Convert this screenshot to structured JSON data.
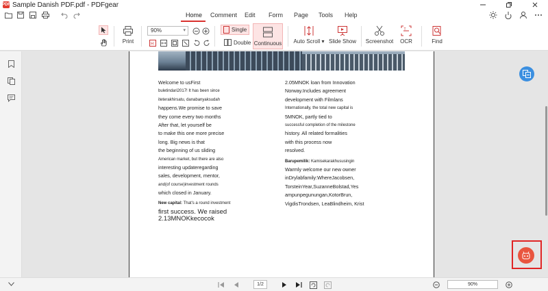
{
  "window": {
    "title": "Sample Danish PDF.pdf - PDFgear",
    "logo_text": "PDF"
  },
  "tabs": [
    {
      "label": "Home"
    },
    {
      "label": "Comment"
    },
    {
      "label": "Edit"
    },
    {
      "label": "Form"
    },
    {
      "label": "Page"
    },
    {
      "label": "Tools"
    },
    {
      "label": "Help"
    }
  ],
  "ribbon": {
    "print": "Print",
    "zoom_value": "90%",
    "single": "Single",
    "double": "Double",
    "continuous": "Continuous",
    "auto_scroll": "Auto Scroll",
    "slide_show": "Slide Show",
    "screenshot": "Screenshot",
    "ocr": "OCR",
    "find": "Find"
  },
  "document": {
    "left_column": [
      "Welcome to usFirst",
      "buletindari2017! It has been since",
      "iteterakhirsatu, danabanyaksudah",
      "happens.We promise to save",
      "they come every two months",
      "After that, let yourself be",
      "to make this one more precise",
      "long. Big news is that",
      "the beginning of us sliding",
      "American market, but there are also",
      "interesting updateregarding",
      "sales, development, mentor,",
      "and(of course)investment rounds",
      "which closed in January."
    ],
    "new_capital_label": "New capital:",
    "new_capital_text": "That's a round investment",
    "big_line_1": "first success. We raised",
    "big_line_2": "2.13MNOKkecocok",
    "right_column": [
      "2.05MNOK loan from Innovation",
      "Norway.Includes agreement",
      "development with Filmlans",
      "Internationally, the total new capital is",
      "5MNOK, partly tied to",
      "successful completion of the milestone",
      "history. All related formalities",
      "with this process now",
      "resolved."
    ],
    "barupemilik_label": "Barupemilik:",
    "barupemilik_first": "Kamisekarakhususingin",
    "right_column_2": [
      "Warmly welcome our new owner",
      "inDrylabfamily:WhereJacobsen,",
      "TorsteinYear,SuzanneBolstad,Yes",
      "ampunpegunungan,KotorBrun,",
      "VigdisTrondsen, LeaBlindheim, Krist"
    ]
  },
  "status": {
    "page_indicator": "1/2",
    "zoom": "90%"
  },
  "colors": {
    "accent": "#d9302c",
    "highlight_frame": "#e02424",
    "float_blue": "#3b8fe0",
    "float_red": "#e9553f"
  }
}
